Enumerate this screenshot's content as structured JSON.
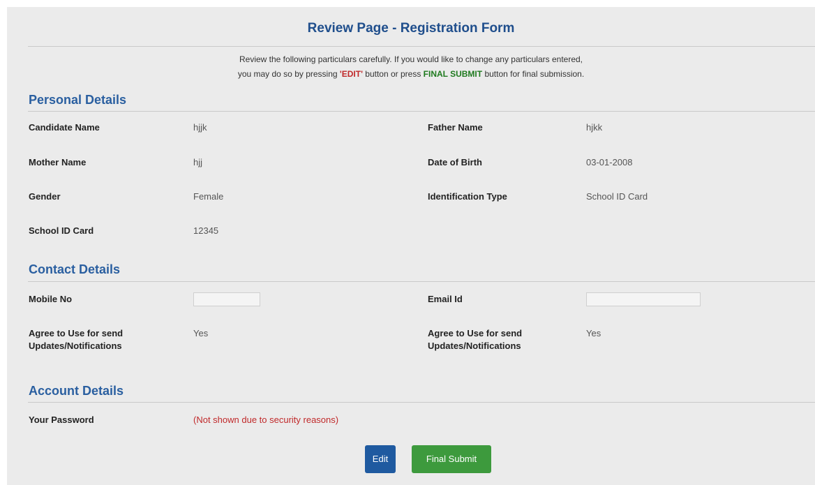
{
  "page": {
    "title": "Review Page - Registration Form",
    "intro": {
      "line1": "Review the following particulars carefully. If you would like to change any particulars entered,",
      "line2_before": "you may do so by pressing ",
      "line2_edit": "'EDIT'",
      "line2_middle": " button or press ",
      "line2_submit": "FINAL SUBMIT",
      "line2_after": " button for final submission."
    }
  },
  "personal": {
    "heading": "Personal Details",
    "candidate_name_label": "Candidate Name",
    "candidate_name_value": "hjjk",
    "father_name_label": "Father Name",
    "father_name_value": "hjkk",
    "mother_name_label": "Mother Name",
    "mother_name_value": "hjj",
    "dob_label": "Date of Birth",
    "dob_value": "03-01-2008",
    "gender_label": "Gender",
    "gender_value": "Female",
    "id_type_label": "Identification Type",
    "id_type_value": "School ID Card",
    "school_id_label": "School ID Card",
    "school_id_value": "12345"
  },
  "contact": {
    "heading": "Contact Details",
    "mobile_label": "Mobile No",
    "email_label": "Email Id",
    "agree_label_1a": "Agree to Use for send",
    "agree_label_1b": "Updates/Notifications",
    "agree_value_1": "Yes",
    "agree_label_2a": "Agree to Use for send",
    "agree_label_2b": "Updates/Notifications",
    "agree_value_2": "Yes"
  },
  "account": {
    "heading": "Account Details",
    "password_label": "Your Password",
    "password_value": "(Not shown due to security reasons)"
  },
  "actions": {
    "edit_label": "Edit",
    "final_submit_label": "Final Submit"
  },
  "colors": {
    "heading_blue": "#2a5fa0",
    "edit_red": "#c0292a",
    "submit_green": "#3d9a3d",
    "button_blue": "#1f5aa0"
  }
}
